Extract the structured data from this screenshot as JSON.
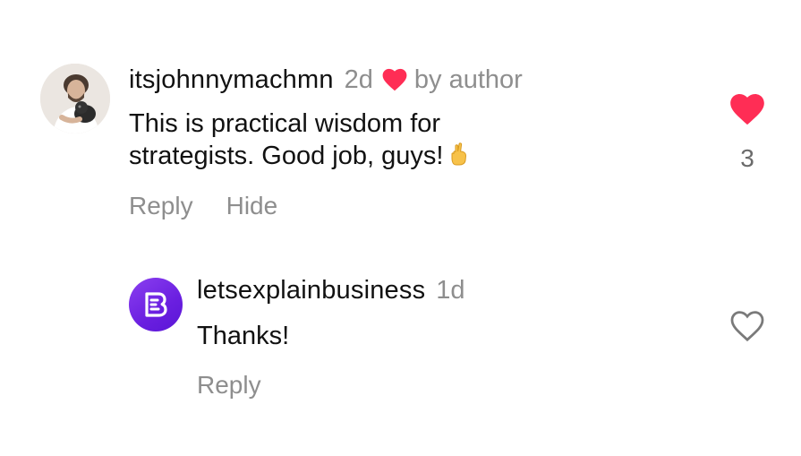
{
  "comments": [
    {
      "username": "itsjohnnymachmn",
      "time": "2d",
      "badge": "by author",
      "text_line1": "This is practical wisdom for",
      "text_line2": "strategists. Good job, guys!",
      "emoji": "fingers-crossed",
      "actions": {
        "reply": "Reply",
        "hide": "Hide"
      },
      "likes": "3",
      "liked": true
    },
    {
      "username": "letsexplainbusiness",
      "time": "1d",
      "text": "Thanks!",
      "actions": {
        "reply": "Reply"
      },
      "liked": false
    }
  ],
  "colors": {
    "like_red": "#ff2d55",
    "muted_gray": "#8e8e8e",
    "brand_purple": "#7a2ee8"
  },
  "icons": [
    "heart-filled-icon",
    "heart-outline-icon",
    "fingers-crossed-emoji"
  ]
}
